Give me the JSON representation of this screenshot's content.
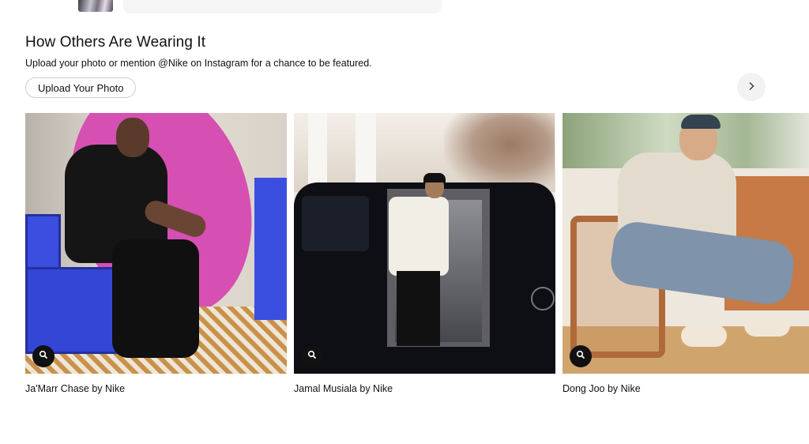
{
  "section": {
    "title": "How Others Are Wearing It",
    "subtitle": "Upload your photo or mention @Nike on Instagram for a chance to be featured.",
    "upload_button_label": "Upload Your Photo"
  },
  "carousel": {
    "next_icon": "chevron-right-icon",
    "zoom_icon": "search-icon",
    "cards": [
      {
        "caption": "Ja'Marr Chase by Nike"
      },
      {
        "caption": "Jamal Musiala by Nike"
      },
      {
        "caption": "Dong Joo by Nike"
      }
    ]
  },
  "colors": {
    "text": "#111111",
    "button_border": "#cfcfcf",
    "nav_button_bg": "#f2f2f2",
    "zoom_badge_bg": "#111111"
  }
}
